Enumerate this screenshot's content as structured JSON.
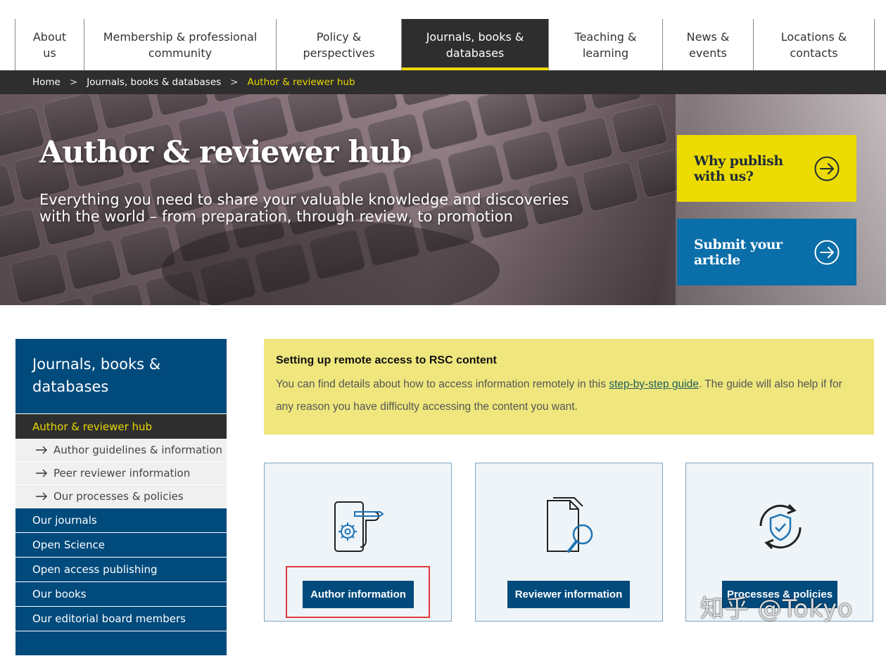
{
  "nav": {
    "items": [
      {
        "label": "About\nus",
        "active": false
      },
      {
        "label": "Membership & professional\ncommunity",
        "active": false
      },
      {
        "label": "Policy &\nperspectives",
        "active": false
      },
      {
        "label": "Journals, books &\ndatabases",
        "active": true
      },
      {
        "label": "Teaching &\nlearning",
        "active": false
      },
      {
        "label": "News &\nevents",
        "active": false
      },
      {
        "label": "Locations &\ncontacts",
        "active": false
      }
    ]
  },
  "breadcrumb": {
    "home": "Home",
    "sep": ">",
    "section": "Journals, books & databases",
    "current": "Author & reviewer hub"
  },
  "hero": {
    "title": "Author & reviewer hub",
    "subtitle": "Everything you need to share your valuable knowledge and discoveries with the world – from preparation, through review, to promotion",
    "cta_primary": "Why publish\nwith us?",
    "cta_secondary": "Submit your\narticle",
    "colors": {
      "yellow": "#ecdb00",
      "blue": "#0a6ea8"
    }
  },
  "sidebar": {
    "heading": "Journals, books & databases",
    "active": "Author & reviewer hub",
    "subitems": [
      "Author guidelines & information",
      "Peer reviewer information",
      "Our processes & policies"
    ],
    "items": [
      "Our journals",
      "Open Science",
      "Open access publishing",
      "Our books",
      "Our editorial board members"
    ]
  },
  "notice": {
    "title": "Setting up remote access to RSC content",
    "text_before": "You can find details about how to access information remotely in this ",
    "link": "step-by-step guide",
    "text_after": ". The guide will also help if for any reason you have difficulty accessing the content you want."
  },
  "cards": [
    {
      "button": "Author information",
      "icon": "document-gear-pen-icon"
    },
    {
      "button": "Reviewer information",
      "icon": "document-magnifier-icon"
    },
    {
      "button": "Processes & policies",
      "icon": "shield-cycle-icon"
    }
  ],
  "watermark": "知乎 @Tokyo",
  "theme": {
    "navy": "#004a7c",
    "dark": "#2e2e2e",
    "accent_yellow": "#e9d900",
    "notice_bg": "#efe77d"
  }
}
